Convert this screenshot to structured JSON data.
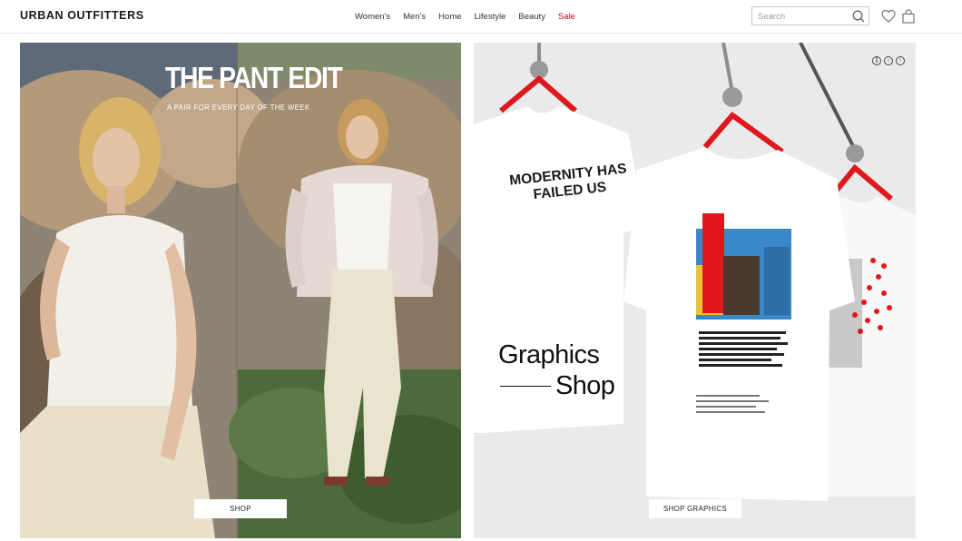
{
  "header": {
    "logo": "URBAN OUTFITTERS",
    "nav": [
      "Women's",
      "Men's",
      "Home",
      "Lifestyle",
      "Beauty",
      "Sale"
    ],
    "sale_color": "#d0021b",
    "search_placeholder": "Search",
    "icons": [
      "search-icon",
      "heart-icon",
      "shopping-bag-icon"
    ]
  },
  "promo_left": {
    "headline": "THE PANT EDIT",
    "subheadline": "A PAIR FOR EVERY DAY OF THE WEEK",
    "cta": "SHOP"
  },
  "promo_right": {
    "title_line1": "Graphics",
    "title_line2": "Shop",
    "tee_print": "MODERNITY HAS FAILED US",
    "cta": "SHOP GRAPHICS",
    "carousel_controls": [
      "pause-icon",
      "previous-icon",
      "next-icon"
    ],
    "accent_color": "#e0181b"
  }
}
